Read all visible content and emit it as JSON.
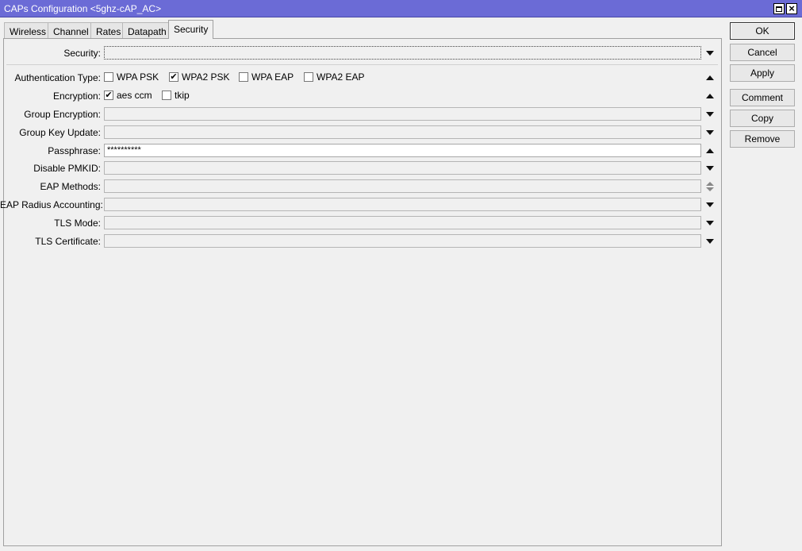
{
  "window": {
    "title": "CAPs Configuration <5ghz-cAP_AC>"
  },
  "tabs": [
    {
      "label": "Wireless"
    },
    {
      "label": "Channel"
    },
    {
      "label": "Rates"
    },
    {
      "label": "Datapath"
    },
    {
      "label": "Security",
      "active": true
    }
  ],
  "form": {
    "security": {
      "label": "Security:",
      "value": ""
    },
    "auth_type": {
      "label": "Authentication Type:",
      "options": [
        {
          "label": "WPA PSK",
          "checked": false
        },
        {
          "label": "WPA2 PSK",
          "checked": true
        },
        {
          "label": "WPA EAP",
          "checked": false
        },
        {
          "label": "WPA2 EAP",
          "checked": false
        }
      ]
    },
    "encryption": {
      "label": "Encryption:",
      "options": [
        {
          "label": "aes ccm",
          "checked": true
        },
        {
          "label": "tkip",
          "checked": false
        }
      ]
    },
    "group_encryption": {
      "label": "Group Encryption:",
      "value": ""
    },
    "group_key_update": {
      "label": "Group Key Update:",
      "value": ""
    },
    "passphrase": {
      "label": "Passphrase:",
      "value": "**********"
    },
    "disable_pmkid": {
      "label": "Disable PMKID:",
      "value": ""
    },
    "eap_methods": {
      "label": "EAP Methods:",
      "value": ""
    },
    "eap_radius_accounting": {
      "label": "EAP Radius Accounting:",
      "value": ""
    },
    "tls_mode": {
      "label": "TLS Mode:",
      "value": ""
    },
    "tls_certificate": {
      "label": "TLS Certificate:",
      "value": ""
    }
  },
  "buttons": {
    "ok": "OK",
    "cancel": "Cancel",
    "apply": "Apply",
    "comment": "Comment",
    "copy": "Copy",
    "remove": "Remove"
  },
  "icons": {
    "maximize": "maximize-icon",
    "close": "close-icon",
    "dropdown": "dropdown-arrow-icon",
    "collapse": "collapse-arrow-icon",
    "updown": "up-down-arrow-icon",
    "check": "checkmark-icon"
  },
  "colors": {
    "titlebar": "#6b6bd6",
    "background": "#f0f0f0"
  }
}
